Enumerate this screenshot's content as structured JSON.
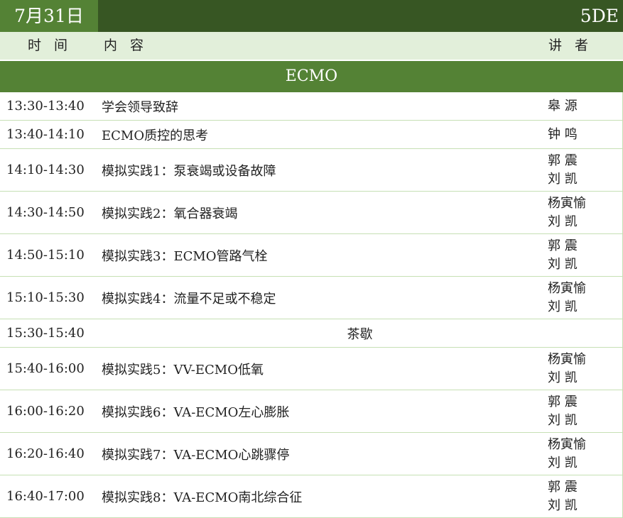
{
  "header": {
    "date": "7月31日",
    "room": "5DE"
  },
  "columns": {
    "time": "时间",
    "content": "内容",
    "speaker": "讲者"
  },
  "section_title": "ECMO",
  "sessions": [
    {
      "time": "13:30-13:40",
      "topic": "学会领导致辞",
      "speakers": [
        "皋 源"
      ]
    },
    {
      "time": "13:40-14:10",
      "topic": "ECMO质控的思考",
      "speakers": [
        "钟 鸣"
      ]
    },
    {
      "time": "14:10-14:30",
      "topic": "模拟实践1：泵衰竭或设备故障",
      "speakers": [
        "郭 震",
        "刘 凯"
      ]
    },
    {
      "time": "14:30-14:50",
      "topic": "模拟实践2：氧合器衰竭",
      "speakers": [
        "杨寅愉",
        "刘 凯"
      ]
    },
    {
      "time": "14:50-15:10",
      "topic": "模拟实践3：ECMO管路气栓",
      "speakers": [
        "郭 震",
        "刘 凯"
      ]
    },
    {
      "time": "15:10-15:30",
      "topic": "模拟实践4：流量不足或不稳定",
      "speakers": [
        "杨寅愉",
        "刘 凯"
      ]
    },
    {
      "time": "15:30-15:40",
      "topic": "茶歇",
      "speakers": [],
      "centered": true
    },
    {
      "time": "15:40-16:00",
      "topic": "模拟实践5：VV-ECMO低氧",
      "speakers": [
        "杨寅愉",
        "刘 凯"
      ]
    },
    {
      "time": "16:00-16:20",
      "topic": "模拟实践6：VA-ECMO左心膨胀",
      "speakers": [
        "郭 震",
        "刘 凯"
      ]
    },
    {
      "time": "16:20-16:40",
      "topic": "模拟实践7：VA-ECMO心跳骤停",
      "speakers": [
        "杨寅愉",
        "刘 凯"
      ]
    },
    {
      "time": "16:40-17:00",
      "topic": "模拟实践8：VA-ECMO南北综合征",
      "speakers": [
        "郭 震",
        "刘 凯"
      ]
    }
  ]
}
